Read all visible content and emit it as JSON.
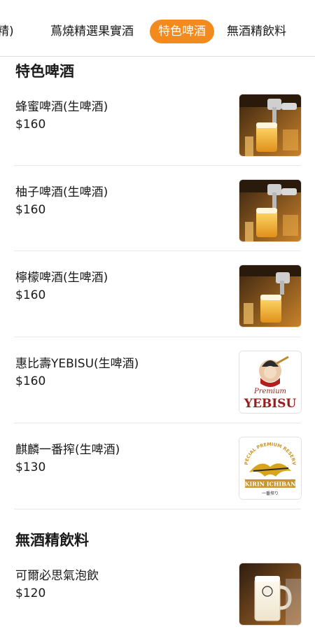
{
  "tabs": [
    {
      "label": "精)"
    },
    {
      "label": "蔦燒精選果實酒"
    },
    {
      "label": "特色啤酒",
      "active": true
    },
    {
      "label": "無酒精飲料"
    }
  ],
  "sections": [
    {
      "title": "特色啤酒",
      "items": [
        {
          "name": "蜂蜜啤酒(生啤酒)",
          "price": "$160",
          "image_icon": "beer-tap-image"
        },
        {
          "name": "柚子啤酒(生啤酒)",
          "price": "$160",
          "image_icon": "beer-tap-image"
        },
        {
          "name": "檸檬啤酒(生啤酒)",
          "price": "$160",
          "image_icon": "beer-tap-image"
        },
        {
          "name": "惠比壽YEBISU(生啤酒)",
          "price": "$160",
          "image_icon": "yebisu-logo"
        },
        {
          "name": "麒麟一番搾(生啤酒)",
          "price": "$130",
          "image_icon": "kirin-logo"
        }
      ]
    },
    {
      "title": "無酒精飲料",
      "items": [
        {
          "name": "可爾必思氣泡飲",
          "price": "$120",
          "image_icon": "beer-mug-image"
        }
      ]
    }
  ],
  "logo_text": {
    "yebisu_script": "Premium",
    "yebisu": "YEBISU",
    "kirin_arc": "SPECIAL PREMIUM RESERVE",
    "kirin_name": "KIRIN ICHIBAN",
    "kirin_sub": "一番搾り"
  },
  "colors": {
    "accent": "#f28a1e",
    "text": "#1a1a1a",
    "yebisu_red": "#9b1b1b",
    "kirin_gold": "#d7a41c"
  }
}
